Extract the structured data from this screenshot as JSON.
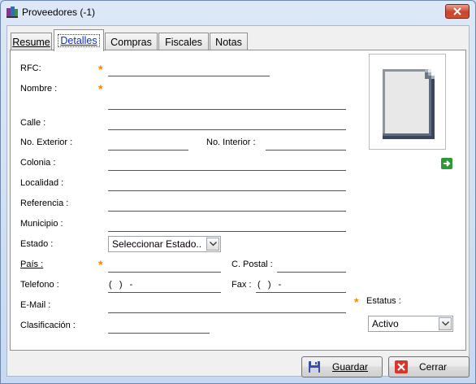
{
  "window": {
    "title": "Proveedores (-1)"
  },
  "tabs": [
    "Resume",
    "Detalles",
    "Compras",
    "Fiscales",
    "Notas"
  ],
  "form": {
    "rfc_label": "RFC:",
    "nombre_label": "Nombre :",
    "calle_label": "Calle :",
    "no_exterior_label": "No. Exterior :",
    "no_interior_label": "No. Interior :",
    "colonia_label": "Colonia :",
    "localidad_label": "Localidad :",
    "referencia_label": "Referencia :",
    "municipio_label": "Municipio :",
    "estado_label": "Estado :",
    "estado_value": "Seleccionar Estado..",
    "pais_label": "País :",
    "cpostal_label": "C. Postal :",
    "telefono_label": "Telefono :",
    "telefono_value": "(   )   -",
    "fax_label": "Fax :",
    "fax_value": "(   )   -",
    "email_label": "E-Mail :",
    "clasificacion_label": "Clasificación :",
    "estatus_label": "Estatus :",
    "estatus_value": "Activo"
  },
  "buttons": {
    "guardar": "Guardar",
    "cerrar": "Cerrar"
  },
  "colors": {
    "required_star": "#f08a00",
    "active_tab_text": "#0b2fd0"
  }
}
